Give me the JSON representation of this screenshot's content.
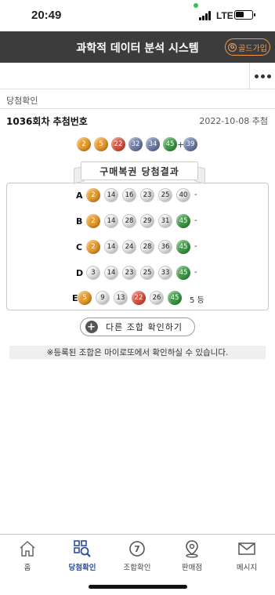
{
  "status": {
    "time": "20:49",
    "network": "LTE",
    "battery_level": 0.55
  },
  "header": {
    "title": "과학적 데이터 분석 시스템",
    "gold_label": "골드가입",
    "gold_icon_text": "G",
    "more_icon": "more-dots-icon"
  },
  "breadcrumb": "당첨확인",
  "draw": {
    "title": "1036회차 추첨번호",
    "date": "2022-10-08 추첨",
    "numbers": [
      "2",
      "5",
      "22",
      "32",
      "34",
      "45"
    ],
    "plus": "+",
    "bonus": "39",
    "colors": [
      "yellow",
      "yellow",
      "red",
      "blue",
      "blue",
      "green",
      "blue"
    ]
  },
  "results": {
    "title": "구매복권 당첨결과",
    "rows": [
      {
        "label": "A",
        "numbers": [
          "2",
          "14",
          "16",
          "23",
          "25",
          "40"
        ],
        "result": "-"
      },
      {
        "label": "B",
        "numbers": [
          "2",
          "14",
          "28",
          "29",
          "31",
          "45"
        ],
        "result": "-"
      },
      {
        "label": "C",
        "numbers": [
          "2",
          "14",
          "24",
          "28",
          "36",
          "45"
        ],
        "result": "-"
      },
      {
        "label": "D",
        "numbers": [
          "3",
          "14",
          "23",
          "25",
          "33",
          "45"
        ],
        "result": "-"
      },
      {
        "label": "E",
        "numbers": [
          "5",
          "9",
          "13",
          "22",
          "26",
          "45"
        ],
        "result": "5 등"
      }
    ]
  },
  "other_combo_label": "다른 조합 확인하기",
  "notice": "※등록된 조합은 마이로또에서 확인하실 수 있습니다.",
  "nav": [
    {
      "label": "홈",
      "icon": "home-icon"
    },
    {
      "label": "당첨확인",
      "icon": "qr-search-icon",
      "active": true
    },
    {
      "label": "조합확인",
      "icon": "lotto-ball-icon",
      "icon_text": "7"
    },
    {
      "label": "판매점",
      "icon": "map-pin-icon"
    },
    {
      "label": "메시지",
      "icon": "envelope-icon"
    }
  ],
  "colors": {
    "header_bg": "#3c3c3c",
    "gold": "#f39a4a",
    "active_nav": "#2d4f9e",
    "ball_yellow": "#e89a2a",
    "ball_red": "#d9533f",
    "ball_blue": "#6f7ea6",
    "ball_green": "#3d9b45"
  }
}
